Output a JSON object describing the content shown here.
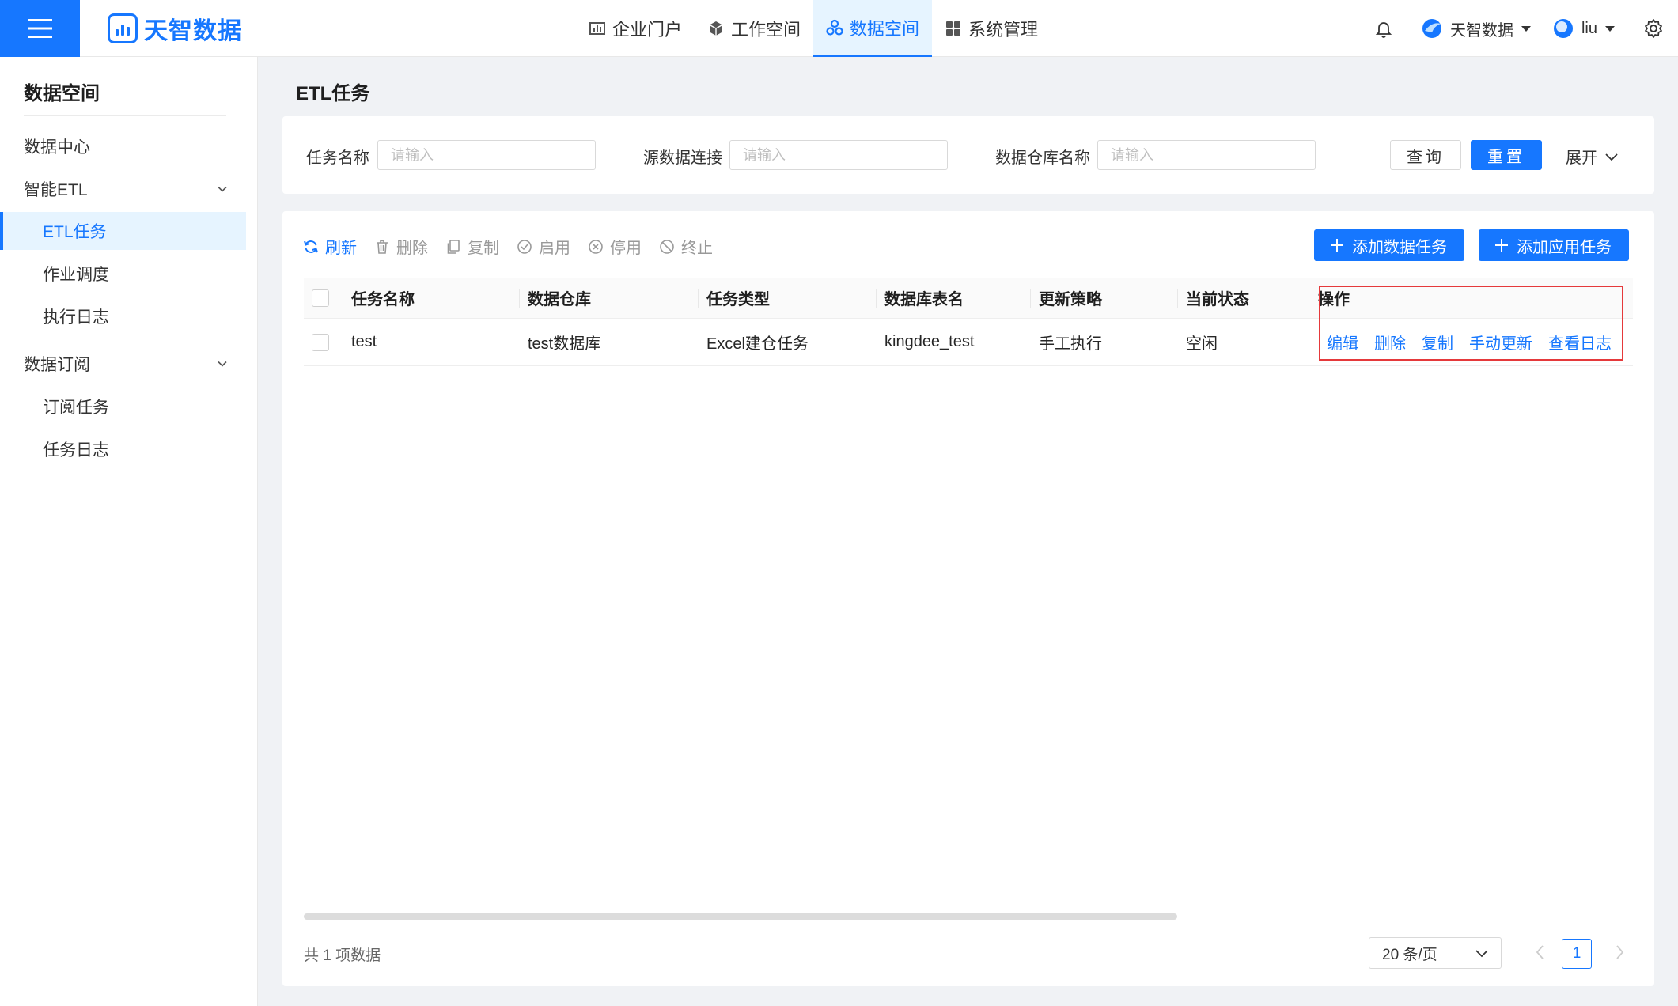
{
  "header": {
    "logo_text": "天智数据",
    "nav": [
      {
        "label": "企业门户",
        "icon": "chart-bar-icon"
      },
      {
        "label": "工作空间",
        "icon": "cube-icon"
      },
      {
        "label": "数据空间",
        "icon": "cluster-icon",
        "active": true
      },
      {
        "label": "系统管理",
        "icon": "grid-icon"
      }
    ],
    "org_name": "天智数据",
    "user_name": "liu"
  },
  "sidebar": {
    "title": "数据空间",
    "items": [
      {
        "label": "数据中心",
        "level": 1
      },
      {
        "label": "智能ETL",
        "level": 1,
        "expandable": true
      },
      {
        "label": "ETL任务",
        "level": 2,
        "active": true
      },
      {
        "label": "作业调度",
        "level": 2
      },
      {
        "label": "执行日志",
        "level": 2
      },
      {
        "label": "数据订阅",
        "level": 1,
        "expandable": true
      },
      {
        "label": "订阅任务",
        "level": 2
      },
      {
        "label": "任务日志",
        "level": 2
      }
    ]
  },
  "page": {
    "title": "ETL任务"
  },
  "filters": {
    "task_name_label": "任务名称",
    "task_name_placeholder": "请输入",
    "source_conn_label": "源数据连接",
    "source_conn_placeholder": "请输入",
    "warehouse_label": "数据仓库名称",
    "warehouse_placeholder": "请输入",
    "query_button": "查询",
    "reset_button": "重置",
    "expand_label": "展开"
  },
  "toolbar": {
    "refresh": "刷新",
    "delete": "删除",
    "copy": "复制",
    "enable": "启用",
    "disable": "停用",
    "terminate": "终止",
    "add_data_task": "添加数据任务",
    "add_app_task": "添加应用任务"
  },
  "table": {
    "columns": [
      "任务名称",
      "数据仓库",
      "任务类型",
      "数据库表名",
      "更新策略",
      "当前状态",
      "操作"
    ],
    "rows": [
      {
        "name": "test",
        "warehouse": "test数据库",
        "type": "Excel建仓任务",
        "table_name": "kingdee_test",
        "strategy": "手工执行",
        "status": "空闲",
        "actions": [
          "编辑",
          "删除",
          "复制",
          "手动更新",
          "查看日志"
        ]
      }
    ]
  },
  "pagination": {
    "total_text": "共 1 项数据",
    "page_size": "20 条/页",
    "current_page": "1"
  },
  "colors": {
    "primary": "#1677ff",
    "highlight_box": "#e5393b"
  }
}
